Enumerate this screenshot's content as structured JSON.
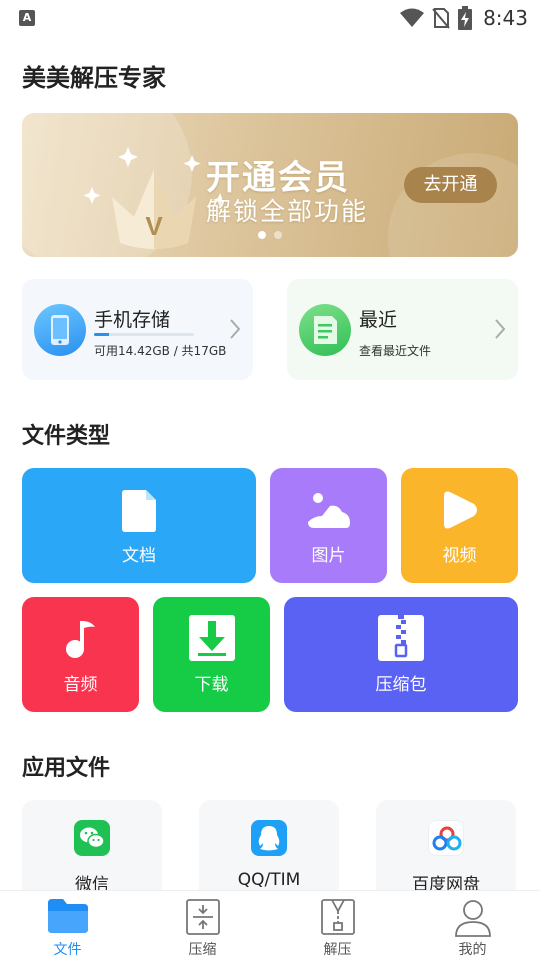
{
  "status_bar": {
    "time": "8:43",
    "app_icon_letter": "A"
  },
  "app": {
    "title": "美美解压专家"
  },
  "banner": {
    "title": "开通会员",
    "subtitle": "解锁全部功能",
    "button_label": "去开通",
    "page_index": 1,
    "page_count": 2,
    "crown_letter": "V"
  },
  "storage_card": {
    "title": "手机存储",
    "subtitle": "可用14.42GB / 共17GB",
    "used_fraction": 0.15
  },
  "recent_card": {
    "title": "最近",
    "subtitle": "查看最近文件"
  },
  "file_types": {
    "heading": "文件类型",
    "items": [
      {
        "label": "文档",
        "color": "#2aa7f7"
      },
      {
        "label": "图片",
        "color": "#a87bfb"
      },
      {
        "label": "视频",
        "color": "#fbb52a"
      },
      {
        "label": "音频",
        "color": "#f9344f"
      },
      {
        "label": "下载",
        "color": "#16cc47"
      },
      {
        "label": "压缩包",
        "color": "#5962f3"
      }
    ]
  },
  "app_files": {
    "heading": "应用文件",
    "items": [
      {
        "label": "微信",
        "icon": "wechat-icon"
      },
      {
        "label": "QQ/TIM",
        "icon": "qq-icon"
      },
      {
        "label": "百度网盘",
        "icon": "baidu-netdisk-icon"
      }
    ]
  },
  "bottom_nav": {
    "active_index": 0,
    "accent_color": "#1e8ef5",
    "items": [
      {
        "label": "文件",
        "icon": "folder-icon"
      },
      {
        "label": "压缩",
        "icon": "compress-icon"
      },
      {
        "label": "解压",
        "icon": "extract-icon"
      },
      {
        "label": "我的",
        "icon": "user-icon"
      }
    ]
  }
}
